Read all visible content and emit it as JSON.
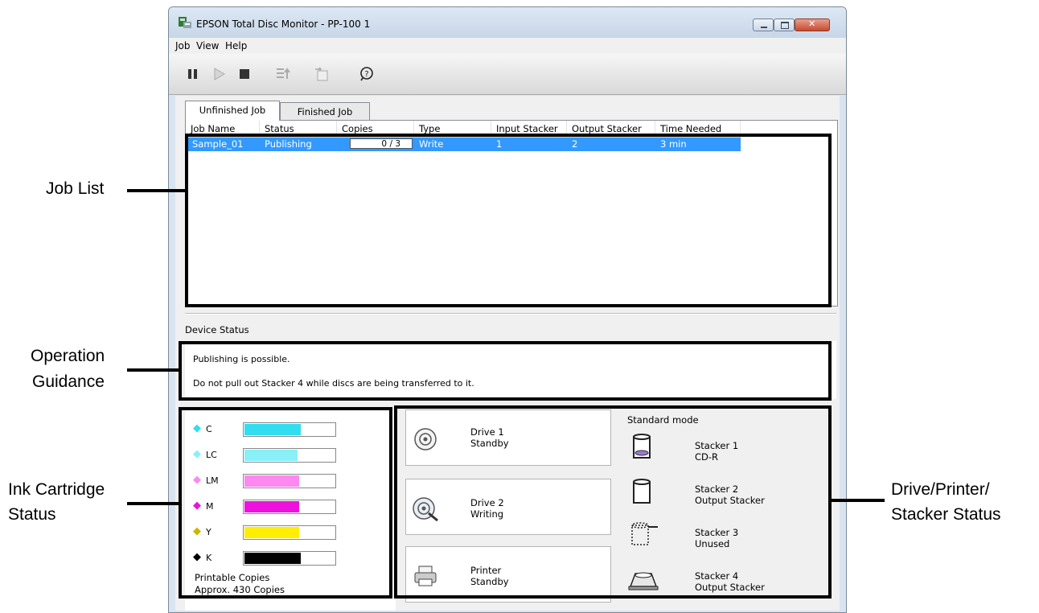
{
  "window": {
    "title": "EPSON Total Disc Monitor - PP-100 1"
  },
  "menu": {
    "job": "Job",
    "view": "View",
    "help": "Help"
  },
  "toolbar": {
    "icons": [
      "pause-icon",
      "play-icon",
      "stop-icon",
      "move-up-icon",
      "move-job-icon",
      "help-icon"
    ]
  },
  "tabs": {
    "unfinished": "Unfinished Job",
    "finished": "Finished Job"
  },
  "job_list": {
    "columns": [
      "Job Name",
      "Status",
      "Copies",
      "Type",
      "Input Stacker",
      "Output Stacker",
      "Time Needed"
    ],
    "rows": [
      {
        "job_name": "Sample_01",
        "status": "Publishing",
        "copies": "0 / 3",
        "type": "Write",
        "input_stacker": "1",
        "output_stacker": "2",
        "time_needed": "3 min"
      }
    ]
  },
  "device_status": {
    "label": "Device Status",
    "guidance_line1": "Publishing is possible.",
    "guidance_line2": "Do not pull out Stacker 4 while discs are being transferred to it."
  },
  "ink": {
    "cartridges": [
      {
        "name": "C",
        "level": 0.61,
        "color": "#33ddf0"
      },
      {
        "name": "LC",
        "level": 0.58,
        "color": "#88f0f6"
      },
      {
        "name": "LM",
        "level": 0.6,
        "color": "#ff88f0"
      },
      {
        "name": "M",
        "level": 0.6,
        "color": "#ee11dd"
      },
      {
        "name": "Y",
        "level": 0.6,
        "color": "#ffee00"
      },
      {
        "name": "K",
        "level": 0.61,
        "color": "#000000"
      }
    ],
    "printable_label": "Printable Copies",
    "printable_value": "Approx. 430 Copies"
  },
  "drives": {
    "drive1_name": "Drive 1",
    "drive1_status": "Standby",
    "drive2_name": "Drive 2",
    "drive2_status": "Writing",
    "printer_name": "Printer",
    "printer_status": "Standby"
  },
  "stackers": {
    "mode": "Standard mode",
    "s1_name": "Stacker 1",
    "s1_status": "CD-R",
    "s2_name": "Stacker 2",
    "s2_status": "Output Stacker",
    "s3_name": "Stacker 3",
    "s3_status": "Unused",
    "s4_name": "Stacker 4",
    "s4_status": "Output Stacker"
  },
  "callouts": {
    "job_list": "Job List",
    "operation_guidance_1": "Operation",
    "operation_guidance_2": "Guidance",
    "ink_status_1": "Ink Cartridge",
    "ink_status_2": "Status",
    "device_status_1": "Drive/Printer/",
    "device_status_2": "Stacker Status"
  },
  "colors": {
    "selection": "#3399ff",
    "callout": "#000000"
  }
}
